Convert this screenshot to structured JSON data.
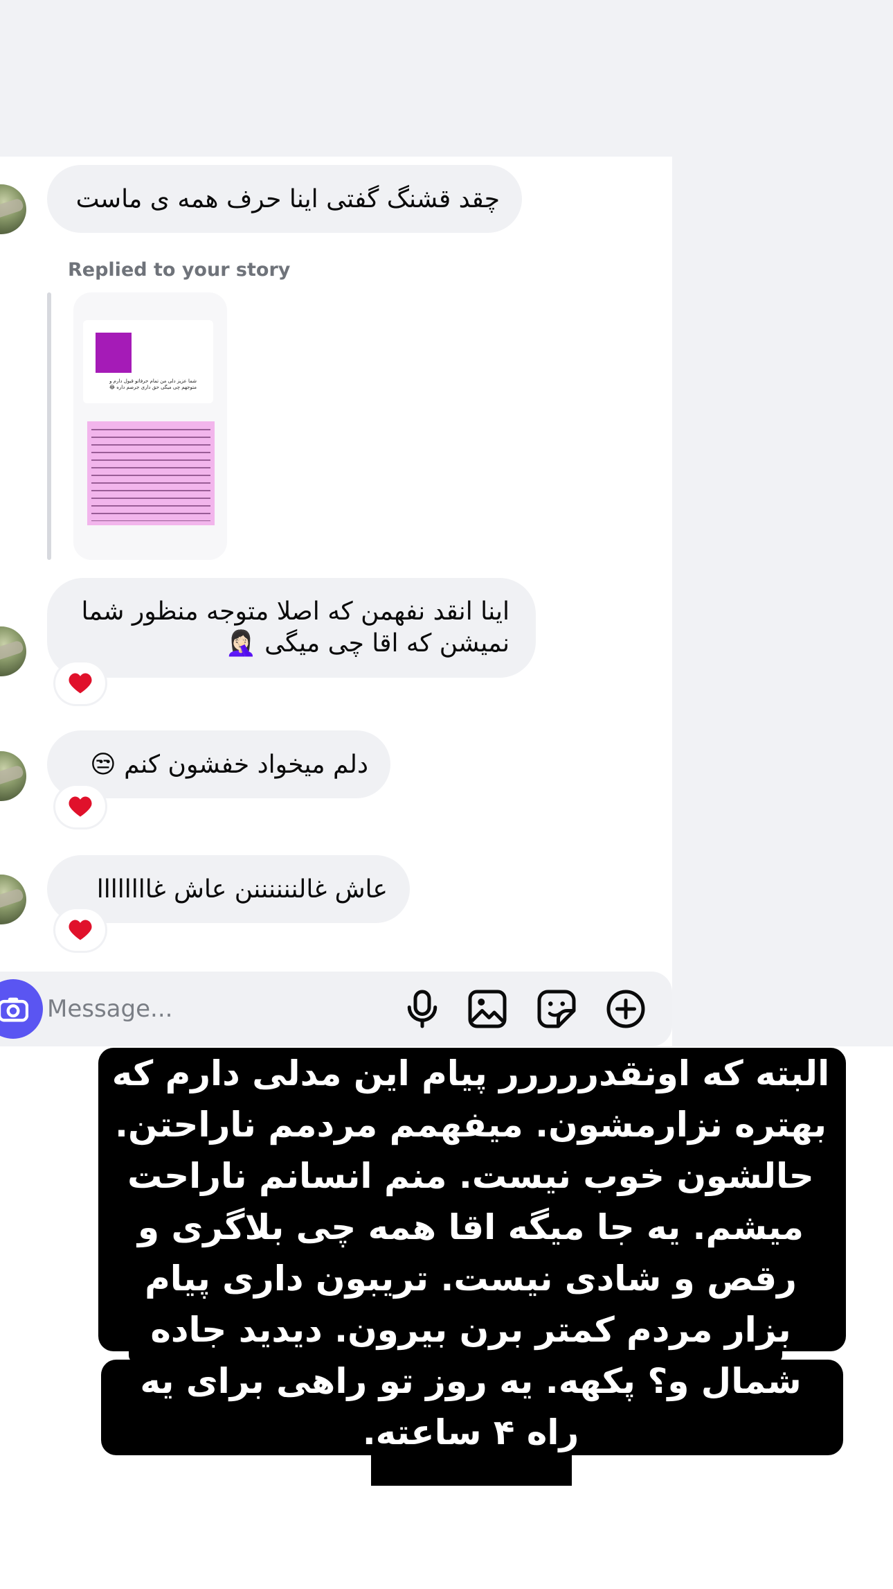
{
  "chat": {
    "messages": [
      {
        "text": "چقد قشنگ گفتی اینا حرف همه ی ماست"
      },
      {
        "text": "اینا انقد نفهمن که اصلا متوجه منظور شما نمیشن که اقا چی میگی 🤦🏻‍♀️",
        "reaction": "heart"
      },
      {
        "text": "دلم میخواد خفشون کنم 😒",
        "reaction": "heart"
      },
      {
        "text": "عاش غالننننننن عاش غاااااااا",
        "reaction": "heart"
      }
    ],
    "reply_label": "Replied to your story",
    "story_preview": {
      "top_text": "شما عزیز دلی من تمام حرفاتو قبول دارم و متوجهم چی میگی حق داری جرصم داره 😂"
    }
  },
  "composer": {
    "placeholder": "Message..."
  },
  "icons": {
    "camera": "camera-icon",
    "mic": "microphone-icon",
    "gallery": "image-icon",
    "sticker": "sticker-icon",
    "add": "plus-circle-icon",
    "reaction": "heart-icon"
  },
  "colors": {
    "bubble": "#f0f1f4",
    "camera_button": "#5a55f2",
    "heart": "#e0112b",
    "overlay_bg": "#000000",
    "overlay_text": "#ffffff"
  },
  "overlay": {
    "text": "البته که اونقدررررر پیام این مدلی دارم که بهتره نزارمشون. میفهمم مردمم ناراحتن. حالشون خوب نیست. منم انسانم ناراحت میشم. یه جا میگه اقا همه چی بلاگری و رقص و شادی نیست. تریبون داری پیام بزار مردم کمتر برن بیرون. دیدید جاده شمال و؟ پکهه. یه روز تو راهی برای یه راه ۴ ساعته."
  }
}
